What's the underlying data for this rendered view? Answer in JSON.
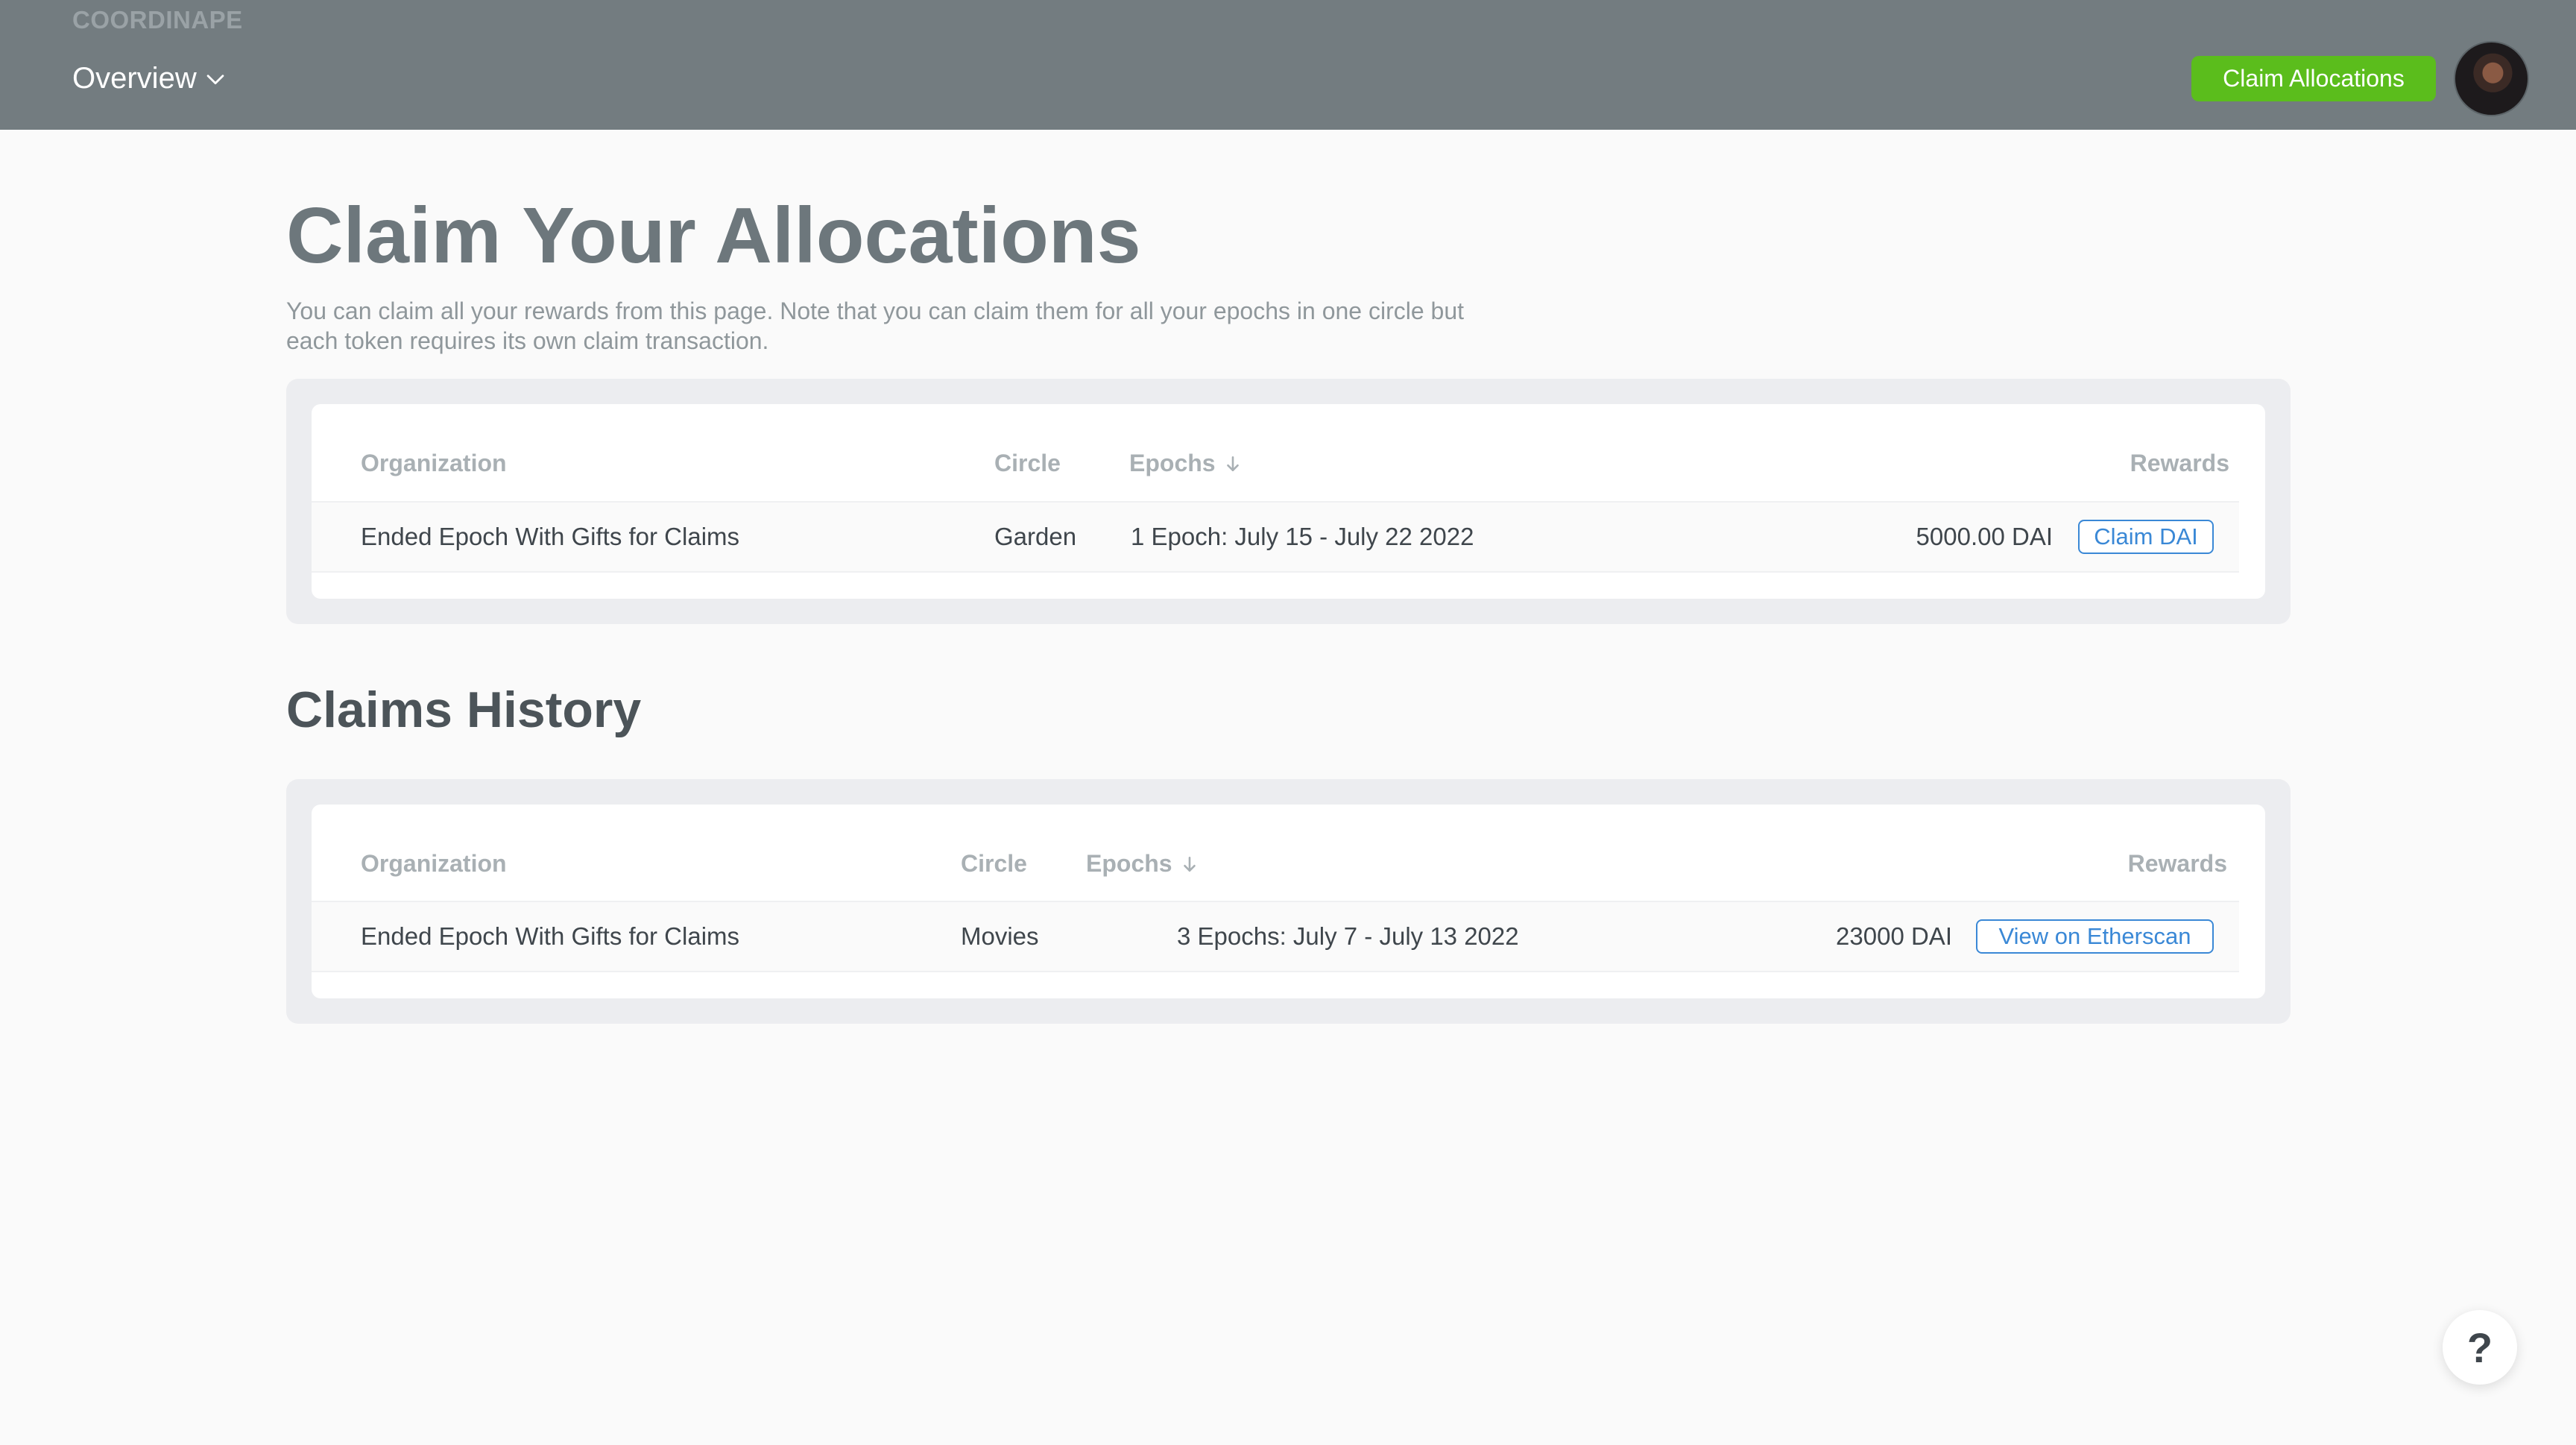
{
  "header": {
    "brand": "COORDINAPE",
    "nav_label": "Overview",
    "claim_button": "Claim Allocations",
    "avatar_icon": "avatar"
  },
  "page": {
    "title": "Claim Your Allocations",
    "description": "You can claim all your rewards from this page. Note that you can claim them for all your epochs in one circle but each token requires its own claim transaction."
  },
  "claims_table": {
    "columns": {
      "organization": "Organization",
      "circle": "Circle",
      "epochs": "Epochs",
      "rewards": "Rewards"
    },
    "rows": [
      {
        "organization": "Ended Epoch With Gifts for Claims",
        "circle": "Garden",
        "epochs": "1 Epoch: July 15 - July 22 2022",
        "rewards": "5000.00 DAI",
        "action": "Claim DAI"
      }
    ]
  },
  "history": {
    "title": "Claims History",
    "columns": {
      "organization": "Organization",
      "circle": "Circle",
      "epochs": "Epochs",
      "rewards": "Rewards"
    },
    "rows": [
      {
        "organization": "Ended Epoch With Gifts for Claims",
        "circle": "Movies",
        "epochs": "3 Epochs: July 7 - July 13 2022",
        "rewards": "23000 DAI",
        "action": "View on Etherscan"
      }
    ]
  },
  "help": {
    "label": "?"
  },
  "colors": {
    "header_bg": "#737c80",
    "claim_green": "#5bbd1c",
    "link_blue": "#3a88d6"
  }
}
